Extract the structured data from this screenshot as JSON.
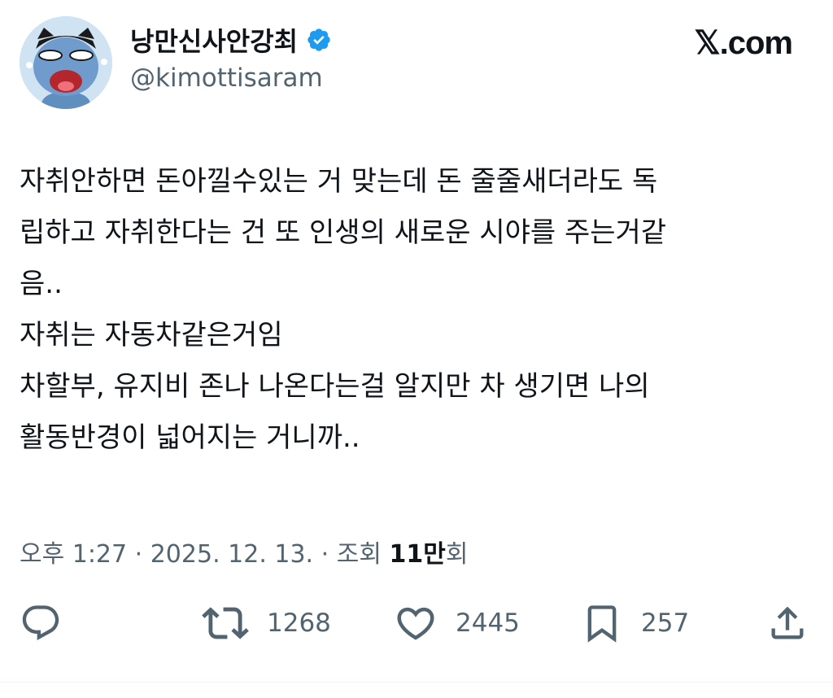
{
  "author": {
    "display_name": "낭만신사안강최",
    "handle": "@kimottisaram",
    "verified_icon": "verified-badge-icon",
    "verified_color": "#1d9bf0"
  },
  "brand": "𝕏.com",
  "tweet": {
    "lines": [
      "자취안하면 돈아낄수있는 거 맞는데 돈 줄줄새더라도 독",
      "립하고 자취한다는 건 또 인생의 새로운 시야를 주는거같",
      "음..",
      "자취는 자동차같은거임",
      "차할부, 유지비 존나 나온다는걸 알지만 차 생기면 나의",
      "활동반경이 넓어지는 거니까.."
    ]
  },
  "meta": {
    "time": "오후 1:27",
    "sep1": " · ",
    "date": "2025. 12. 13.",
    "sep2": " · ",
    "views_prefix": "조회 ",
    "views_count": "11만",
    "views_suffix": "회"
  },
  "actions": {
    "reply": {
      "icon": "reply-icon",
      "count": ""
    },
    "retweet": {
      "icon": "retweet-icon",
      "count": "1268"
    },
    "like": {
      "icon": "heart-icon",
      "count": "2445"
    },
    "bookmark": {
      "icon": "bookmark-icon",
      "count": "257"
    },
    "share": {
      "icon": "share-icon",
      "count": ""
    }
  }
}
